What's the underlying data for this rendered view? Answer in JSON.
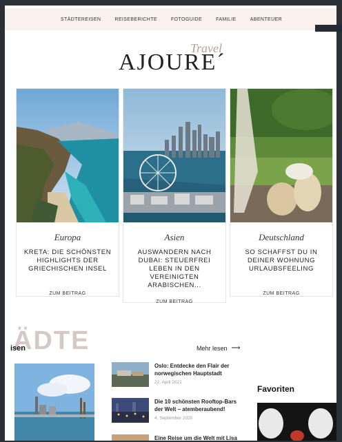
{
  "nav": {
    "items": [
      "STÄDTEREISEN",
      "REISEBERICHTE",
      "FOTOGUIDE",
      "FAMILIE",
      "ABENTEUER"
    ]
  },
  "logo": {
    "word": "AJOURE´",
    "script": "Travel"
  },
  "cards": [
    {
      "category": "Europa",
      "title": "KRETA: DIE SCHÖNSTEN HIGHLIGHTS DER GRIECHISCHEN INSEL",
      "cta": "ZUM BEITRAG"
    },
    {
      "category": "Asien",
      "title": "AUSWANDERN NACH DUBAI: STEUERFREI LEBEN IN DEN VEREINIGTEN ARABISCHEN...",
      "cta": "ZUM BEITRAG"
    },
    {
      "category": "Deutschland",
      "title": "SO SCHAFFST DU IN DEINER WOHNUNG URLAUBSFEELING",
      "cta": "ZUM BEITRAG"
    }
  ],
  "section": {
    "big_word": "ÄDTE",
    "label": "isen",
    "more": "Mehr lesen",
    "favorites": "Favoriten"
  },
  "posts": [
    {
      "title": "Oslo: Entdecke den Flair der norwegischen Hauptstadt",
      "date": "22. April 2021"
    },
    {
      "title": "Die 10 schönsten Rooftop-Bars der Welt – atemberaubend!",
      "date": "4. September 2020"
    },
    {
      "title": "Eine Reise um die Welt mit Lisa",
      "date": ""
    }
  ]
}
